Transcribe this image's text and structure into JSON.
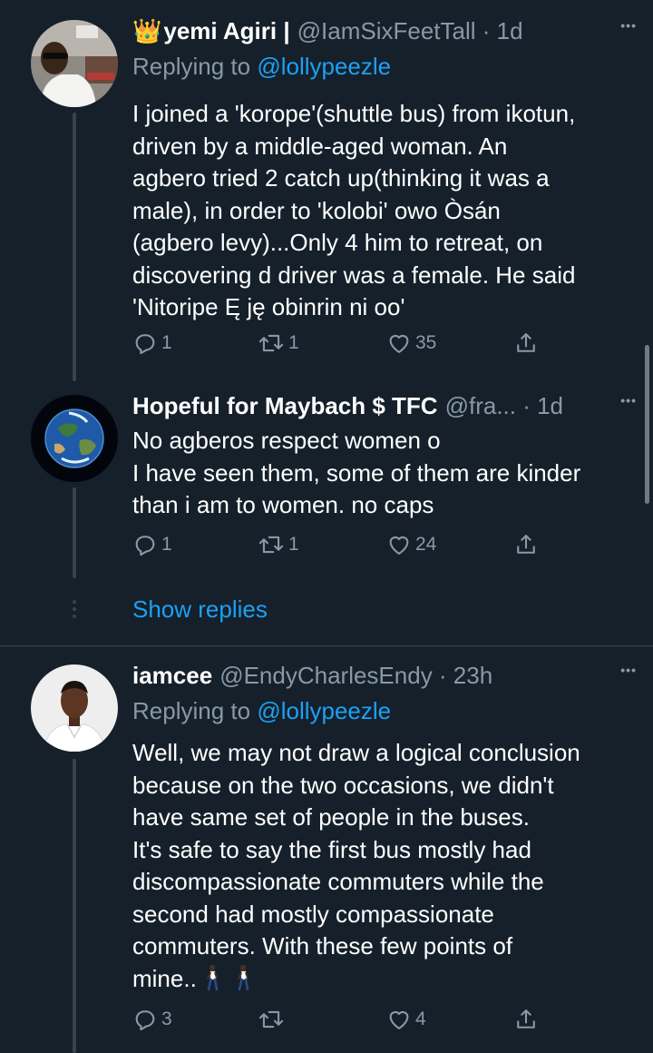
{
  "colors": {
    "background": "#15202b",
    "text": "#ffffff",
    "secondary": "#8899a6",
    "accent": "#1da1f2",
    "divider": "#38444d"
  },
  "tweets": [
    {
      "name": "yemi Agiri |",
      "crown": "👑",
      "handle_time": "@IamSixFeetTall · 1d",
      "replying_prefix": "Replying to ",
      "replying_handle": "@lollypeezle",
      "lines": [
        "I joined a 'korope'(shuttle bus) from ikotun,",
        "driven by a middle-aged woman. An",
        "agbero tried 2 catch up(thinking it was a",
        "male), in order to 'kolobi' owo Òsán",
        "(agbero levy)...Only 4 him to retreat, on",
        "discovering d driver was a female. He said",
        "'Nitoripe Ę ję obinrin ni oo'"
      ],
      "replies": "1",
      "retweets": "1",
      "likes": "35",
      "more_icon": "more-icon"
    },
    {
      "name": "Hopeful for Maybach $ TFC",
      "handle_time": "@fra... · 1d",
      "lines": [
        "No agberos respect women o",
        "I have seen them, some of them are kinder",
        "than i am to women. no caps"
      ],
      "replies": "1",
      "retweets": "1",
      "likes": "24",
      "more_icon": "more-icon"
    },
    {
      "name": "iamcee",
      "handle_time": "@EndyCharlesEndy · 23h",
      "replying_prefix": "Replying to ",
      "replying_handle": "@lollypeezle",
      "lines": [
        "Well, we may not draw a logical conclusion",
        "because on the two occasions, we didn't",
        "have same set of people in the buses.",
        "It's safe to say the first bus mostly had",
        "discompassionate commuters while the",
        "second had mostly compassionate",
        "commuters. With these few points of",
        "mine.."
      ],
      "replies": "3",
      "retweets": "",
      "likes": "4",
      "more_icon": "more-icon"
    }
  ],
  "show_replies": "Show replies",
  "more_dots": "•••"
}
